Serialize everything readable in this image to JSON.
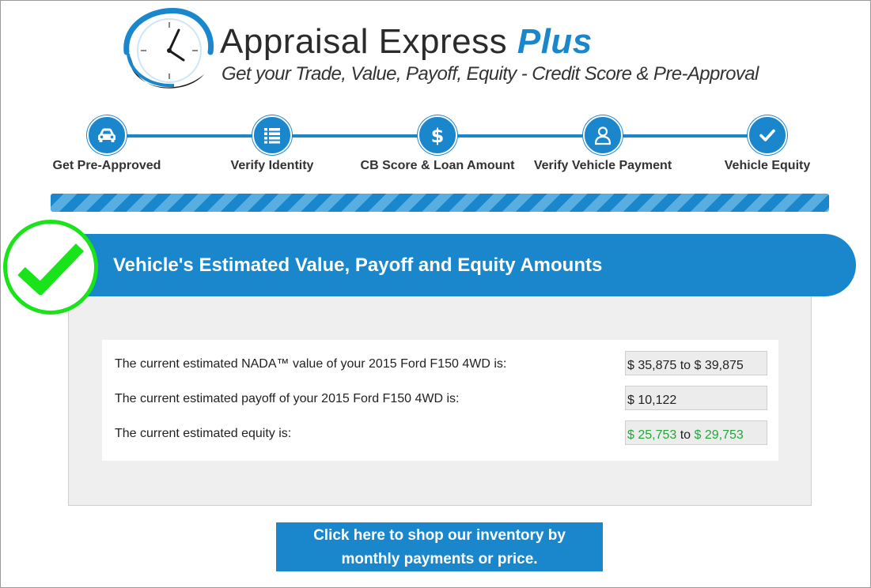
{
  "colors": {
    "primary": "#1a87cc",
    "success": "#19e319",
    "equity_text": "#22a83a",
    "panel_bg": "#efefef"
  },
  "logo": {
    "title_main": "Appraisal Express",
    "title_accent": "Plus",
    "tagline": "Get your Trade, Value, Payoff, Equity - Credit Score & Pre-Approval"
  },
  "steps": [
    {
      "label": "Get Pre-Approved",
      "icon": "car-icon"
    },
    {
      "label": "Verify Identity",
      "icon": "list-icon"
    },
    {
      "label": "CB Score & Loan Amount",
      "icon": "dollar-icon"
    },
    {
      "label": "Verify Vehicle Payment",
      "icon": "user-icon"
    },
    {
      "label": "Vehicle Equity",
      "icon": "checkmark-icon"
    }
  ],
  "progress": {
    "percent": 100
  },
  "banner": {
    "title": "Vehicle's Estimated Value, Payoff and Equity Amounts",
    "icon": "checkmark-badge-icon"
  },
  "results": {
    "nada_label": "The current estimated NADA™ value of your 2015 Ford F150 4WD is:",
    "nada_low": "$ 35,875",
    "nada_sep": "to",
    "nada_high": "$ 39,875",
    "payoff_label": "The current estimated payoff of your 2015 Ford F150 4WD is:",
    "payoff_value": "$ 10,122",
    "equity_label": "The current estimated equity is:",
    "equity_low": "$ 25,753",
    "equity_sep": "to",
    "equity_high": "$ 29,753"
  },
  "cta": {
    "line1": "Click here to shop our inventory by",
    "line2": "monthly payments or price."
  }
}
